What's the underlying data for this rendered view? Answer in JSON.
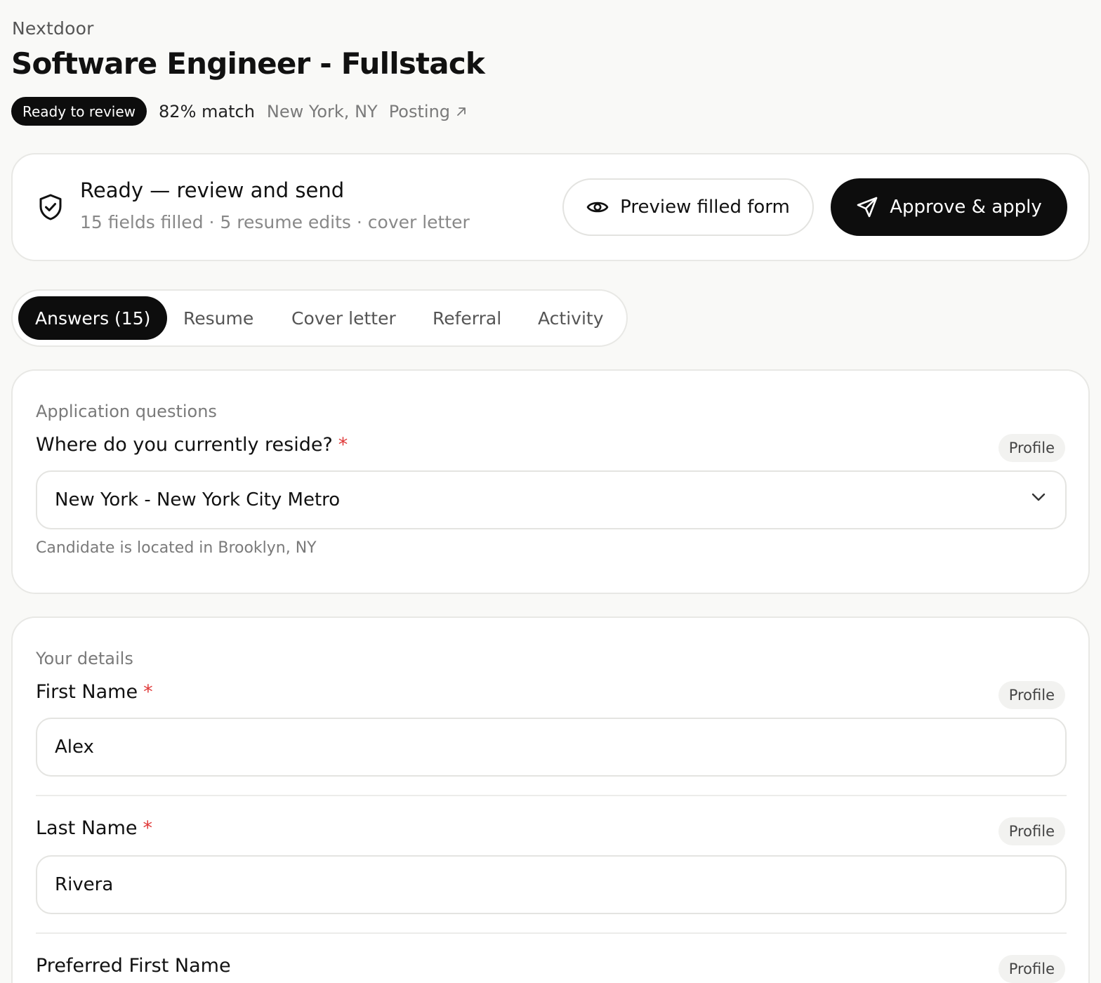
{
  "header": {
    "company": "Nextdoor",
    "job_title": "Software Engineer - Fullstack",
    "status": "Ready to review",
    "match": "82% match",
    "location": "New York, NY",
    "posting_link": "Posting"
  },
  "action_card": {
    "title": "Ready — review and send",
    "subtitle": "15 fields filled · 5 resume edits · cover letter",
    "preview_button": "Preview filled form",
    "approve_button": "Approve & apply"
  },
  "tabs": [
    {
      "label": "Answers (15)",
      "active": true
    },
    {
      "label": "Resume",
      "active": false
    },
    {
      "label": "Cover letter",
      "active": false
    },
    {
      "label": "Referral",
      "active": false
    },
    {
      "label": "Activity",
      "active": false
    }
  ],
  "sections": {
    "application_questions": {
      "title": "Application questions",
      "questions": [
        {
          "label": "Where do you currently reside?",
          "required": "*",
          "source": "Profile",
          "value": "New York - New York City Metro",
          "hint": "Candidate is located in Brooklyn, NY"
        }
      ]
    },
    "your_details": {
      "title": "Your details",
      "fields": [
        {
          "label": "First Name",
          "required": "*",
          "source": "Profile",
          "value": "Alex"
        },
        {
          "label": "Last Name",
          "required": "*",
          "source": "Profile",
          "value": "Rivera"
        },
        {
          "label": "Preferred First Name",
          "source": "Profile"
        }
      ]
    }
  },
  "colors": {
    "accent_dark": "#0d0d0d",
    "required": "#e03a3a",
    "background": "#f9f9f7"
  },
  "icons": [
    "arrow-up-right-icon",
    "shield-check-icon",
    "eye-icon",
    "send-icon",
    "chevron-down-icon"
  ]
}
